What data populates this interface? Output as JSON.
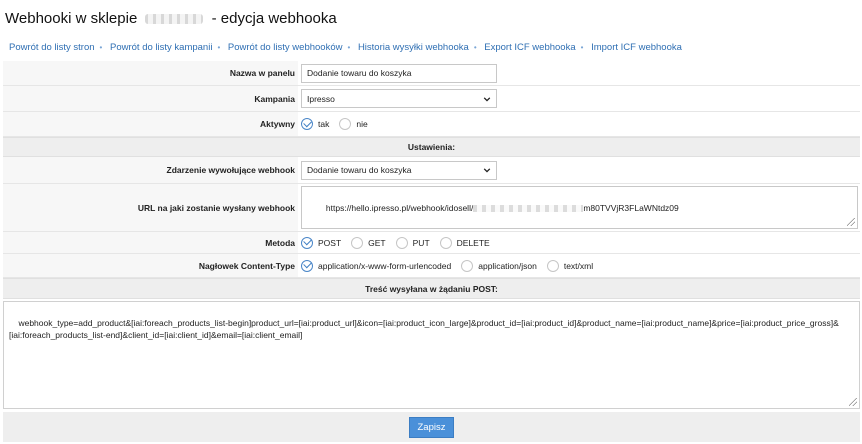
{
  "header": {
    "title_prefix": "Webhooki w sklepie",
    "title_suffix": "- edycja webhooka"
  },
  "breadcrumb": [
    "Powrót do listy stron",
    "Powrót do listy kampanii",
    "Powrót do listy webhooków",
    "Historia wysyłki webhooka",
    "Export ICF webhooka",
    "Import ICF webhooka"
  ],
  "form": {
    "name_label": "Nazwa w panelu",
    "name_value": "Dodanie towaru do koszyka",
    "campaign_label": "Kampania",
    "campaign_value": "Ipresso",
    "active_label": "Aktywny",
    "active_options": [
      "tak",
      "nie"
    ],
    "active_selected": "tak",
    "settings_header": "Ustawienia:",
    "event_label": "Zdarzenie wywołujące webhook",
    "event_value": "Dodanie towaru do koszyka",
    "url_label": "URL na jaki zostanie wysłany webhook",
    "url_prefix": "https://hello.ipresso.pl/webhook/idosell/",
    "url_suffix": "m80TVVjR3FLaWNtdz09",
    "method_label": "Metoda",
    "methods": [
      "POST",
      "GET",
      "PUT",
      "DELETE"
    ],
    "method_selected": "POST",
    "content_type_label": "Nagłowek Content-Type",
    "content_types": [
      "application/x-www-form-urlencoded",
      "application/json",
      "text/xml"
    ],
    "content_type_selected": "application/x-www-form-urlencoded",
    "body_header": "Treść wysyłana w żądaniu POST:",
    "body_value": "webhook_type=add_product&[iai:foreach_products_list-begin]product_url=[iai:product_url]&icon=[iai:product_icon_large]&product_id=[iai:product_id]&product_name=[iai:product_name]&price=[iai:product_price_gross]&[iai:foreach_products_list-end]&client_id=[iai:client_id]&email=[iai:client_email]"
  },
  "footer": {
    "save_label": "Zapisz"
  },
  "colors": {
    "link": "#2f6fb3",
    "button": "#4a90d9",
    "radio_check": "#3f7fc4"
  },
  "icons": [
    "chevron-down-icon",
    "check-icon",
    "resize-handle-icon"
  ]
}
